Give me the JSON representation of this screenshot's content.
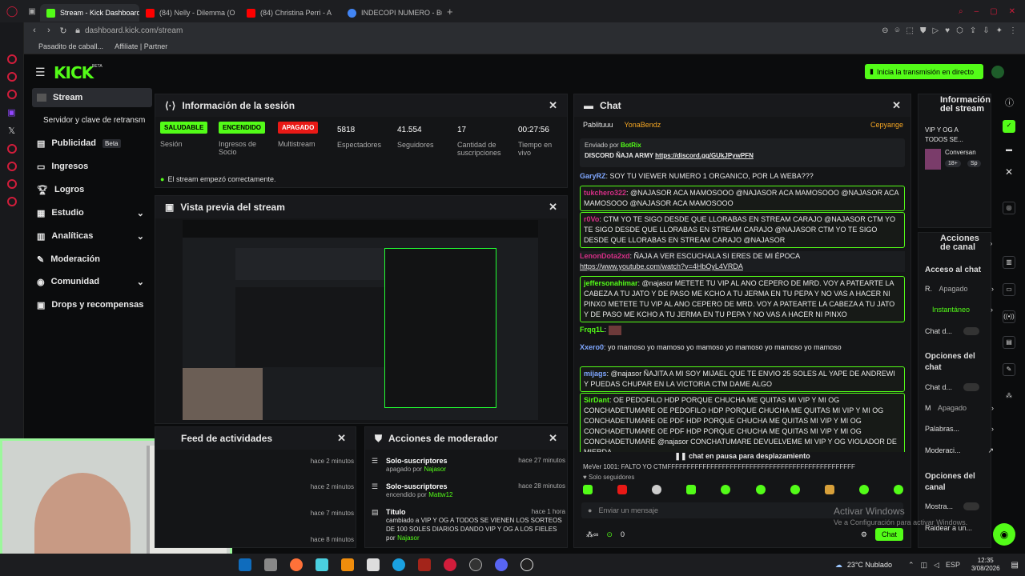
{
  "tabs": [
    {
      "label": "Stream - Kick Dashboard",
      "color": "#53fc18"
    },
    {
      "label": "(84) Nelly - Dilemma (O",
      "color": "#ff0000"
    },
    {
      "label": "(84) Christina Perri - A",
      "color": "#ff0000"
    },
    {
      "label": "INDECOPI NUMERO - Busc",
      "color": "#4285f4"
    }
  ],
  "address": "dashboard.kick.com/stream",
  "bookmarks": [
    "Pasadito de caball...",
    "Affiliate | Partner"
  ],
  "header": {
    "logo": "KICK",
    "logo_beta": "BETA",
    "live_button": "Inicia la transmisión en directo"
  },
  "sidebar": [
    {
      "label": "Stream",
      "active": true
    },
    {
      "label": "Servidor y clave de retransm"
    },
    {
      "label": "Publicidad",
      "badge": "Beta"
    },
    {
      "label": "Ingresos"
    },
    {
      "label": "Logros"
    },
    {
      "label": "Estudio",
      "chevron": true
    },
    {
      "label": "Analíticas",
      "chevron": true
    },
    {
      "label": "Moderación"
    },
    {
      "label": "Comunidad",
      "chevron": true
    },
    {
      "label": "Drops y recompensas"
    }
  ],
  "session": {
    "title": "Información de la sesión",
    "stats": [
      {
        "badge": "SALUDABLE",
        "badge_color": "#53fc18",
        "label": "Sesión"
      },
      {
        "badge": "ENCENDIDO",
        "badge_color": "#53fc18",
        "label": "Ingresos de Socio"
      },
      {
        "badge": "APAGADO",
        "badge_color": "#e91916",
        "label": "Multistream"
      },
      {
        "value": "5818",
        "label": "Espectadores"
      },
      {
        "value": "41.554",
        "label": "Seguidores"
      },
      {
        "value": "17",
        "label": "Cantidad de suscripciones"
      },
      {
        "value": "00:27:56",
        "label": "Tiempo en vivo"
      }
    ],
    "status": "El stream empezó correctamente."
  },
  "preview": {
    "title": "Vista previa del stream"
  },
  "feed": {
    "title": "Feed de actividades",
    "times": [
      "hace 2 minutos",
      "hace 2 minutos",
      "hace 7 minutos",
      "hace 8 minutos"
    ]
  },
  "modactions": {
    "title": "Acciones de moderador",
    "rows": [
      {
        "title": "Solo-suscriptores",
        "sub": "apagado por",
        "user": "Najasor",
        "time": "hace 27 minutos"
      },
      {
        "title": "Solo-suscriptores",
        "sub": "encendido por",
        "user": "Mattw12",
        "time": "hace 28 minutos"
      },
      {
        "title": "Título",
        "sub": "cambiado a VIP Y OG A TODOS SE VIENEN LOS SORTEOS DE 100 SOLES DIARIOS DANDO VIP Y OG A LOS FIELES por",
        "user": "Najasor",
        "time": "hace 1 hora"
      }
    ]
  },
  "chat": {
    "title": "Chat",
    "pinned_users": [
      "Pablituuu",
      "YonaBendz",
      "Cepyange"
    ],
    "pinned_by": "Enviado por",
    "pinned_bot": "BotRix",
    "pinned_msg": "DISCORD ÑAJA ARMY",
    "pinned_link": "https://discord.gg/GUkJPywPFN",
    "messages": [
      {
        "user": "GaryRZ",
        "color": "#7fa7ff",
        "text": "SOY TU VIEWER NUMERO 1 ORGANICO, POR LA WEBA???",
        "hl": false
      },
      {
        "user": "tukchero322",
        "color": "#d62e86",
        "text": "@NAJASOR ACA MAMOSOOO @NAJASOR ACA MAMOSOOO @NAJASOR ACA MAMOSOOO @NAJASOR ACA MAMOSOOO",
        "hl": true
      },
      {
        "user": "r0Vo",
        "color": "#d62e86",
        "text": "CTM YO TE SIGO DESDE QUE LLORABAS EN STREAM CARAJO @NAJASOR CTM YO TE SIGO DESDE QUE LLORABAS EN STREAM CARAJO @NAJASOR CTM YO TE SIGO DESDE QUE LLORABAS EN STREAM CARAJO @NAJASOR",
        "hl": true
      },
      {
        "user": "LenonDota2xd",
        "color": "#d62e86",
        "text": "ÑAJA A VER ESCUCHALA SI ERES DE MI ÉPOCA",
        "link": "https://www.youtube.com/watch?v=4HbOyL4VRDA",
        "hl": false
      },
      {
        "user": "jeffersonahimar",
        "color": "#53fc18",
        "text": "@najasor METETE TU VIP AL ANO CEPERO DE MRD. VOY A PATEARTE LA CABEZA A TU JATO Y DE PASO ME KCHO A TU JERMA EN TU PEPA Y NO VAS A HACER NI PINXO METETE TU VIP AL ANO CEPERO DE MRD. VOY A PATEARTE LA CABEZA A TU JATO Y DE PASO ME KCHO A TU JERMA EN TU PEPA Y NO VAS A HACER NI PINXO",
        "hl": true
      },
      {
        "user": "Frqq1L",
        "color": "#53fc18",
        "text": "",
        "hl": false
      },
      {
        "user": "Xxero0",
        "color": "#7fa7ff",
        "text": "yo mamoso yo mamoso yo mamoso yo mamoso yo mamoso yo mamoso",
        "hl": false
      },
      {
        "user": "mijags",
        "color": "#7fa7ff",
        "text": "@najasor ÑAJITA A MI SOY MIJAEL QUE TE ENVIO 25 SOLES AL YAPE DE ANDREWI Y PUEDAS CHUPAR EN LA VICTORIA CTM DAME ALGO",
        "hl": true
      },
      {
        "user": "SirDant",
        "color": "#53fc18",
        "text": "OE PEDOFILO HDP PORQUE CHUCHA ME QUITAS MI VIP Y MI OG CONCHADETUMARE OE PEDOFILO HDP PORQUE CHUCHA ME QUITAS MI VIP Y MI OG CONCHADETUMARE OE PDF HDP PORQUE CHUCHA ME QUITAS MI VIP Y MI OG CONCHADETUMARE OE PDF HDP PORQUE CHUCHA ME QUITAS MI VIP Y MI OG CONCHADETUMARE @najasor CONCHATUMARE DEVUELVEME MI VIP Y OG VIOLADOR DE MIERDA",
        "hl": true
      }
    ],
    "paused": "chat en pausa para desplazamiento",
    "partial": "MeVer 1001: FALTO YO CTMFFFFFFFFFFFFFFFFFFFFFFFFFFFFFFFFFFFFFFFFFFFFFFFF",
    "followers_only": "Solo seguidores",
    "input_placeholder": "Enviar un mensaje",
    "count": "0",
    "send": "Chat"
  },
  "stream_info": {
    "title": "Información del stream",
    "stream_title": "VIP Y OG A TODOS SE...",
    "category": "Conversan",
    "tag1": "18+",
    "tag2": "Sp"
  },
  "channel_actions": {
    "title": "Acciones de canal",
    "access_title": "Acceso al chat",
    "r_label": "R.",
    "r_value": "Apagado",
    "instant": "Instantáneo",
    "chat_d1": "Chat d...",
    "chat_opts": "Opciones del chat",
    "chat_d2": "Chat d...",
    "m_label": "M",
    "m_value": "Apagado",
    "palabras": "Palabras...",
    "moderaci": "Moderaci...",
    "canal_opts": "Opciones del canal",
    "mostra": "Mostra...",
    "raidear": "Raidear a un..."
  },
  "watermark": {
    "line1": "Activar Windows",
    "line2": "Ve a Configuración para activar Windows."
  },
  "taskbar": {
    "weather": "23°C  Nublado",
    "lang": "ESP",
    "time": "12:35",
    "date": "3/08/2026"
  }
}
